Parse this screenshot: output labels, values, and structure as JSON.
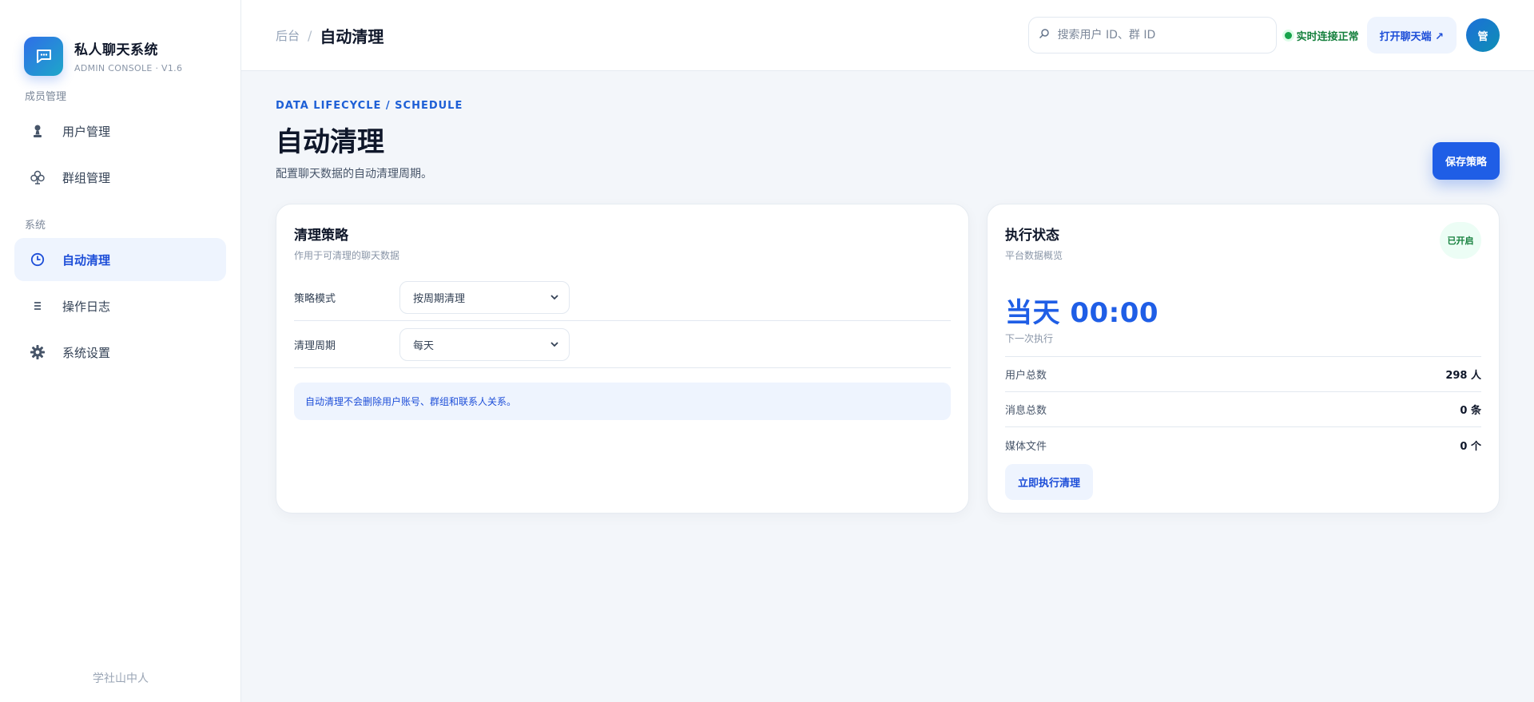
{
  "brand": {
    "title": "私人聊天系统",
    "subtitle": "ADMIN CONSOLE · V1.6",
    "logo_icon": "chat-bubble-icon"
  },
  "sidebar": {
    "sections": [
      {
        "label": "成员管理",
        "items": [
          {
            "label": "用户管理",
            "icon": "user-icon",
            "active": false
          },
          {
            "label": "群组管理",
            "icon": "group-icon",
            "active": false
          }
        ]
      },
      {
        "label": "系统",
        "items": [
          {
            "label": "自动清理",
            "icon": "clock-icon",
            "active": true
          },
          {
            "label": "操作日志",
            "icon": "list-icon",
            "active": false
          },
          {
            "label": "系统设置",
            "icon": "gear-icon",
            "active": false
          }
        ]
      }
    ],
    "footer": "学社山中人"
  },
  "topbar": {
    "breadcrumb_root": "后台",
    "breadcrumb_sep": "/",
    "breadcrumb_current": "自动清理",
    "search_placeholder": "搜索用户 ID、群 ID",
    "status_text": "实时连接正常",
    "open_chat_label": "打开聊天端 ↗",
    "avatar_text": "管"
  },
  "page": {
    "eyebrow": "DATA LIFECYCLE / SCHEDULE",
    "title": "自动清理",
    "description": "配置聊天数据的自动清理周期。",
    "save_label": "保存策略"
  },
  "policy_card": {
    "title": "清理策略",
    "subtitle": "作用于可清理的聊天数据",
    "mode_label": "策略模式",
    "mode_value": "按周期清理",
    "period_label": "清理周期",
    "period_value": "每天",
    "notice": "自动清理不会删除用户账号、群组和联系人关系。"
  },
  "status_card": {
    "title": "执行状态",
    "subtitle": "平台数据概览",
    "badge": "已开启",
    "next_time": "当天 00:00",
    "next_label": "下一次执行",
    "stats": [
      {
        "label": "用户总数",
        "value": "298 人"
      },
      {
        "label": "消息总数",
        "value": "0 条"
      },
      {
        "label": "媒体文件",
        "value": "0 个"
      }
    ],
    "run_label": "立即执行清理"
  },
  "colors": {
    "accent": "#1f5ee6",
    "success": "#16a34a",
    "sidebar_active_bg": "#eef4fe"
  }
}
